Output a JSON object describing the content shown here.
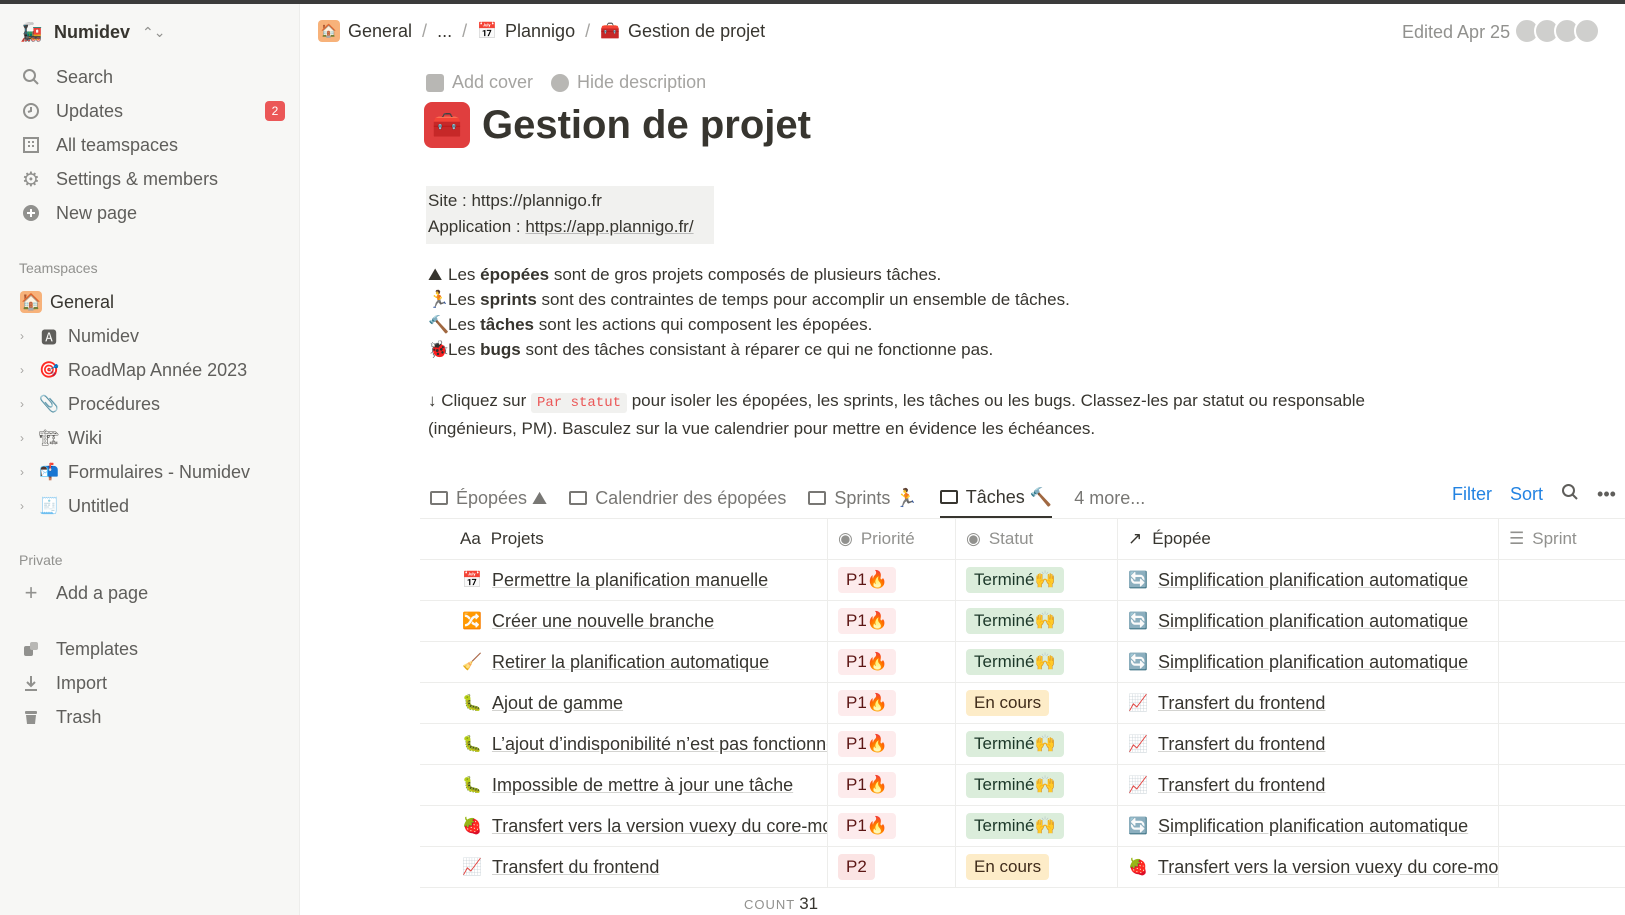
{
  "workspace": {
    "name": "Numidev",
    "icon": "🚂"
  },
  "sidebar": {
    "nav": [
      {
        "label": "Search",
        "icon": "search-icon"
      },
      {
        "label": "Updates",
        "icon": "clock-icon",
        "badge": "2"
      },
      {
        "label": "All teamspaces",
        "icon": "building-icon"
      },
      {
        "label": "Settings & members",
        "icon": "gear-icon"
      },
      {
        "label": "New page",
        "icon": "plus-circle-icon"
      }
    ],
    "teamspaces_label": "Teamspaces",
    "teamspaces": [
      {
        "label": "General",
        "emoji": "🏠",
        "active": true
      },
      {
        "label": "Numidev",
        "emoji": "🅰"
      },
      {
        "label": "RoadMap Année 2023",
        "emoji": "🎯"
      },
      {
        "label": "Procédures",
        "emoji": "📎"
      },
      {
        "label": "Wiki",
        "emoji": "🏗"
      },
      {
        "label": "Formulaires - Numidev",
        "emoji": "📬"
      },
      {
        "label": "Untitled",
        "emoji": "🧾"
      }
    ],
    "private_label": "Private",
    "add_page": "Add a page",
    "bottom": [
      {
        "label": "Templates",
        "icon": "templates-icon"
      },
      {
        "label": "Import",
        "icon": "download-icon"
      },
      {
        "label": "Trash",
        "icon": "trash-icon"
      }
    ]
  },
  "breadcrumb": {
    "items": [
      {
        "label": "General",
        "emoji": "🏠"
      },
      {
        "label": "..."
      },
      {
        "label": "Plannigo",
        "emoji": "📅"
      },
      {
        "label": "Gestion de projet",
        "emoji": "🧰"
      }
    ]
  },
  "header": {
    "edited": "Edited Apr 25"
  },
  "page": {
    "add_cover": "Add cover",
    "hide_description": "Hide description",
    "title": "Gestion de projet",
    "title_emoji": "🧰",
    "callout": {
      "site": "Site : https://plannigo.fr",
      "app_prefix": "Application : ",
      "app_link": "https://app.plannigo.fr/"
    },
    "legend": [
      {
        "emoji": "⛰",
        "pre": "Les ",
        "bold": "épopées",
        "post": " sont de gros projets composés de plusieurs tâches."
      },
      {
        "emoji": "🏃",
        "pre": "Les ",
        "bold": "sprints",
        "post": " sont des contraintes de temps pour accomplir un ensemble de tâches."
      },
      {
        "emoji": "🔨",
        "pre": "Les ",
        "bold": "tâches",
        "post": " sont les actions qui composent les épopées."
      },
      {
        "emoji": "🐞",
        "pre": "Les ",
        "bold": "bugs",
        "post": " sont des tâches consistant à réparer ce qui ne fonctionne pas."
      }
    ],
    "hint_pre": "↓ Cliquez sur ",
    "hint_code": "Par statut",
    "hint_post": " pour isoler les épopées, les sprints, les tâches ou les bugs. Classez-les par statut ou responsable",
    "hint_line2": "(ingénieurs, PM). Basculez sur la vue calendrier pour mettre en évidence les échéances."
  },
  "views": {
    "tabs": [
      {
        "label": "Épopées ⛰",
        "icon": "table-icon"
      },
      {
        "label": "Calendrier des épopées",
        "icon": "calendar-icon"
      },
      {
        "label": "Sprints 🏃",
        "icon": "board-icon"
      },
      {
        "label": "Tâches 🔨",
        "icon": "table-icon",
        "active": true
      }
    ],
    "more": "4 more...",
    "filter": "Filter",
    "sort": "Sort"
  },
  "table": {
    "columns": [
      "Projets",
      "Priorité",
      "Statut",
      "Épopée",
      "Sprint"
    ],
    "rows": [
      {
        "emoji": "📅",
        "name": "Permettre la planification manuelle",
        "priority": "P1🔥",
        "status": "Terminé🙌",
        "status_type": "done",
        "epic_emoji": "🔄",
        "epic": "Simplification planification automatique"
      },
      {
        "emoji": "🔀",
        "name": "Créer une nouvelle branche",
        "priority": "P1🔥",
        "status": "Terminé🙌",
        "status_type": "done",
        "epic_emoji": "🔄",
        "epic": "Simplification planification automatique"
      },
      {
        "emoji": "🧹",
        "name": "Retirer la planification automatique",
        "priority": "P1🔥",
        "status": "Terminé🙌",
        "status_type": "done",
        "epic_emoji": "🔄",
        "epic": "Simplification planification automatique"
      },
      {
        "emoji": "🐛",
        "name": "Ajout de gamme",
        "priority": "P1🔥",
        "status": "En cours",
        "status_type": "wip",
        "epic_emoji": "📈",
        "epic": "Transfert du frontend"
      },
      {
        "emoji": "🐛",
        "name": "L’ajout d’indisponibilité n’est pas fonctionnel",
        "priority": "P1🔥",
        "status": "Terminé🙌",
        "status_type": "done",
        "epic_emoji": "📈",
        "epic": "Transfert du frontend"
      },
      {
        "emoji": "🐛",
        "name": "Impossible de mettre à jour une tâche",
        "priority": "P1🔥",
        "status": "Terminé🙌",
        "status_type": "done",
        "epic_emoji": "📈",
        "epic": "Transfert du frontend"
      },
      {
        "emoji": "🍓",
        "name": "Transfert vers la version vuexy du core-mo",
        "priority": "P1🔥",
        "status": "Terminé🙌",
        "status_type": "done",
        "epic_emoji": "🔄",
        "epic": "Simplification planification automatique"
      },
      {
        "emoji": "📈",
        "name": "Transfert du frontend",
        "priority": "P2",
        "status": "En cours",
        "status_type": "wip",
        "epic_emoji": "🍓",
        "epic": "Transfert vers la version vuexy du core-mo"
      }
    ],
    "count_label": "COUNT",
    "count": "31"
  }
}
